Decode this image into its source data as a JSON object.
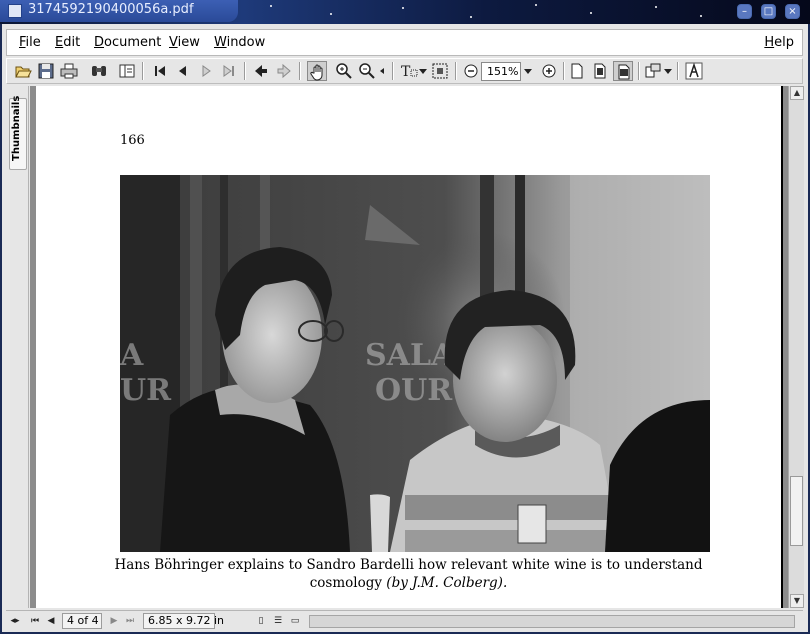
{
  "window": {
    "title": "3174592190400056a.pdf"
  },
  "menu": [
    {
      "label": "File",
      "hot": "F",
      "rest": "ile"
    },
    {
      "label": "Edit",
      "hot": "E",
      "rest": "dit"
    },
    {
      "label": "Document",
      "hot": "D",
      "rest": "ocument"
    },
    {
      "label": "View",
      "hot": "V",
      "rest": "iew"
    },
    {
      "label": "Window",
      "hot": "W",
      "rest": "indow"
    }
  ],
  "help": {
    "hot": "H",
    "rest": "elp"
  },
  "toolbar": {
    "zoom_value": "151%"
  },
  "thumbnails": {
    "label": "Thumbnails"
  },
  "document": {
    "page_number": "166",
    "caption_main": "Hans Böhringer explains to Sandro Bardelli how relevant white wine is to understand cosmology",
    "caption_credit": "(by J.M. Colberg)."
  },
  "status": {
    "page_indicator": "4 of 4",
    "page_size": "6.85 x 9.72 in"
  },
  "colors": {
    "desktop": "#1a2a55",
    "title_tab": "#2a4a98",
    "page": "#ffffff"
  }
}
